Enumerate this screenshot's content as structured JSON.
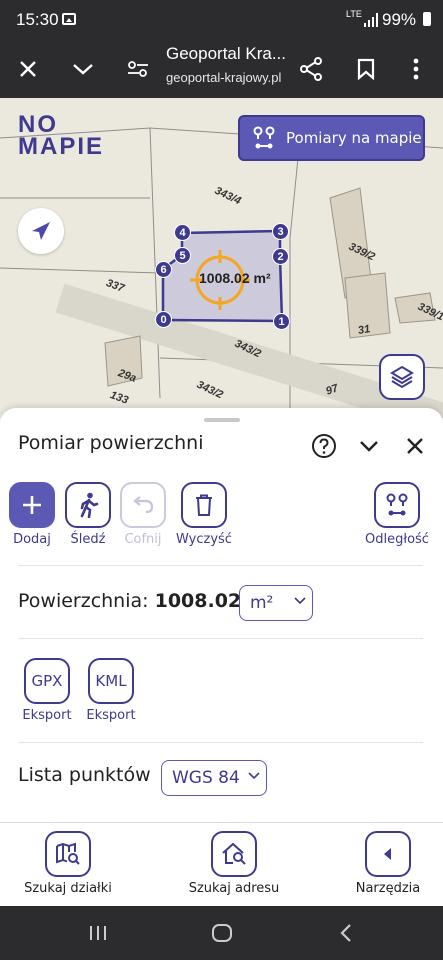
{
  "status": {
    "time": "15:30",
    "network": "LTE",
    "battery": "99%"
  },
  "browser": {
    "title": "Geoportal Kra...",
    "url": "geoportal-krajowy.pl"
  },
  "map": {
    "logo_line1": "NO",
    "logo_line2": "MAPIE",
    "measure_button": "Pomiary na mapie",
    "area_label": "1008.02 m²",
    "parcel_labels": [
      "343/4",
      "339/2",
      "337",
      "343/2",
      "31",
      "339/1",
      "29a",
      "343/2",
      "97",
      "133"
    ],
    "points": [
      "4",
      "3",
      "5",
      "2",
      "6",
      "0",
      "1"
    ]
  },
  "panel": {
    "title": "Pomiar powierzchni",
    "tools": {
      "add": "Dodaj",
      "track": "Śledź",
      "undo": "Cofnij",
      "clear": "Wyczyść",
      "distance": "Odległość"
    },
    "area_prefix": "Powierzchnia:",
    "area_value": "1008.02",
    "unit": "m²",
    "exports": [
      {
        "code": "GPX",
        "label": "Eksport"
      },
      {
        "code": "KML",
        "label": "Eksport"
      }
    ],
    "points_list_label": "Lista punktów",
    "coord_system": "WGS 84"
  },
  "bottom_nav": {
    "search_parcel": "Szukaj działki",
    "search_address": "Szukaj adresu",
    "tools": "Narzędzia"
  },
  "colors": {
    "accent": "#3d3a8f",
    "accent_light": "#5c59b5",
    "target": "#f5a623"
  }
}
